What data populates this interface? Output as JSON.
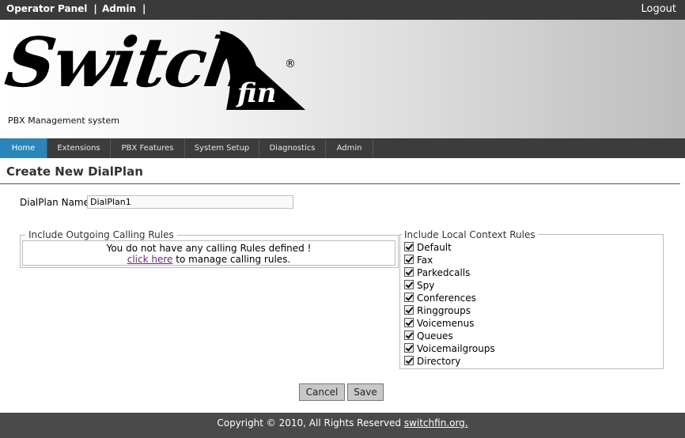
{
  "topbar": {
    "links": [
      "Operator Panel",
      "Admin"
    ],
    "logout": "Logout"
  },
  "banner": {
    "logo_text": "Switch",
    "logo_fin": "fin",
    "registered": "®",
    "tagline": "PBX Management system"
  },
  "nav": {
    "tabs": [
      "Home",
      "Extensions",
      "PBX Features",
      "System Setup",
      "Diagnostics",
      "Admin"
    ],
    "active": "Home"
  },
  "page": {
    "title": "Create New DialPlan",
    "dialplan_label": "DialPlan Name",
    "dialplan_value": "DialPlan1"
  },
  "outgoing": {
    "legend": "Include Outgoing Calling Rules",
    "message": "You do not have any calling Rules defined !",
    "link_text": "click here",
    "link_suffix": " to manage calling rules."
  },
  "local": {
    "legend": "Include Local Context Rules",
    "items": [
      "Default",
      "Fax",
      "Parkedcalls",
      "Spy",
      "Conferences",
      "Ringgroups",
      "Voicemenus",
      "Queues",
      "Voicemailgroups",
      "Directory"
    ]
  },
  "buttons": {
    "cancel": "Cancel",
    "save": "Save"
  },
  "footer": {
    "text": "Copyright © 2010, All Rights Reserved ",
    "link": "switchfin.org."
  }
}
